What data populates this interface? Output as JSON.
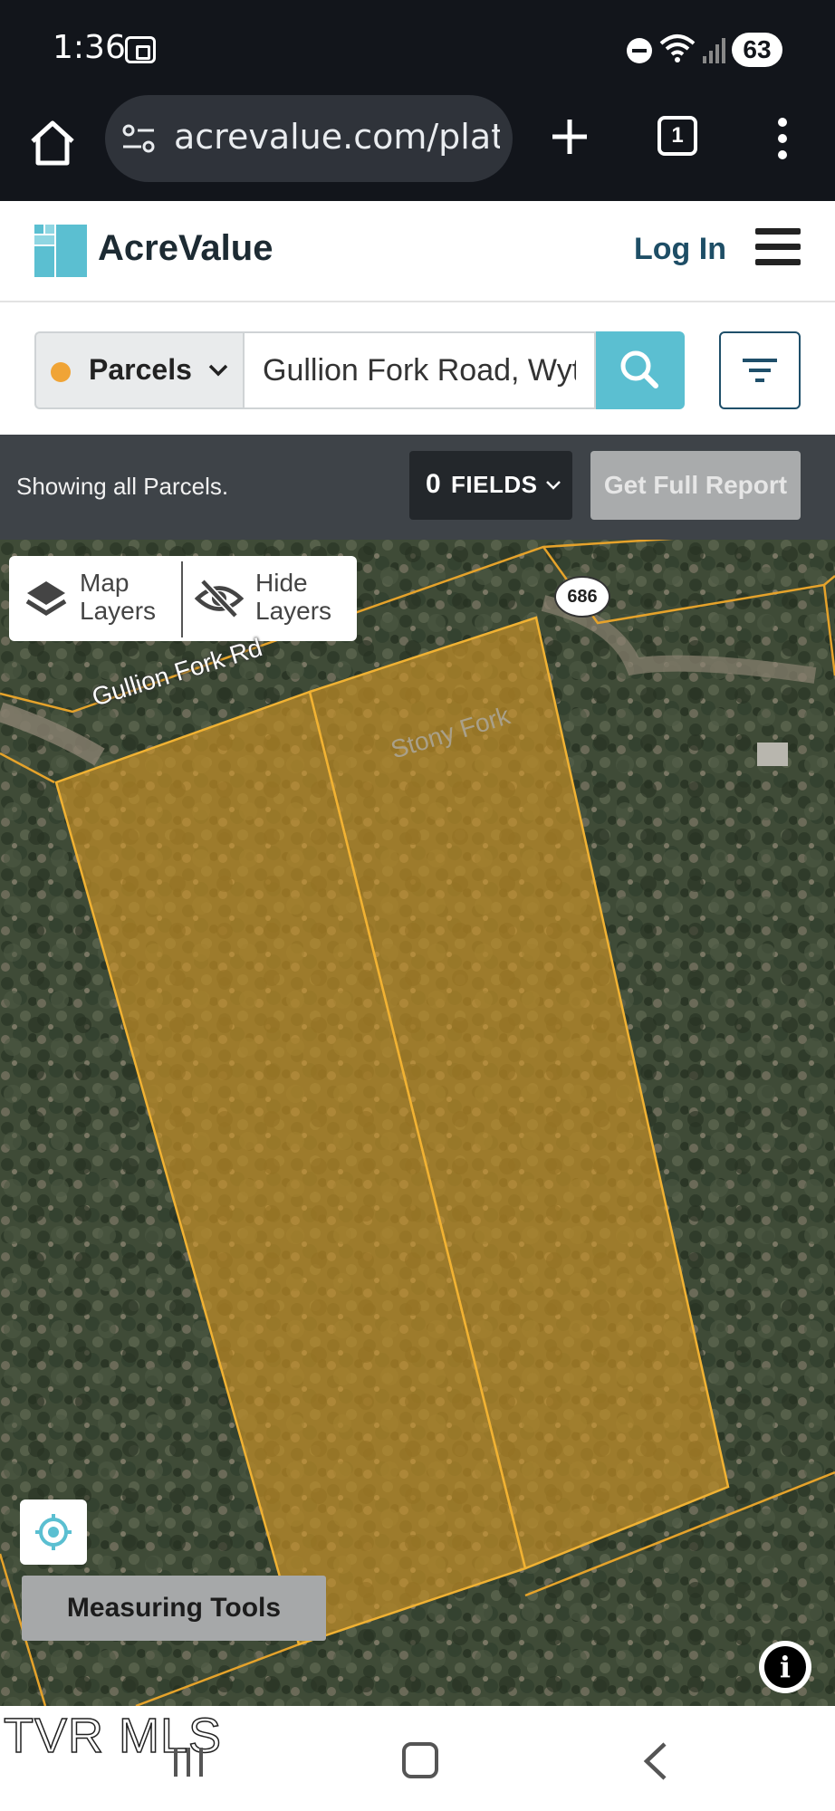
{
  "status_bar": {
    "time": "1:36",
    "battery": "63",
    "icons": [
      "screenshot-icon",
      "do-not-disturb-icon",
      "wifi-icon",
      "signal-icon",
      "battery-icon"
    ]
  },
  "browser": {
    "url": "acrevalue.com/plat-r",
    "tab_count": "1"
  },
  "header": {
    "brand": "AcreValue",
    "login_label": "Log In",
    "brand_colors": [
      "#5bbfd1",
      "#1d2b33"
    ]
  },
  "search": {
    "layer_selected": "Parcels",
    "layer_dot_color": "#f0a436",
    "query": "Gullion Fork Road, Wytl"
  },
  "info_bar": {
    "message": "Showing all Parcels.",
    "fields_count": "0",
    "fields_label": "FIELDS",
    "report_label": "Get Full Report"
  },
  "map": {
    "map_layers_label_1": "Map",
    "map_layers_label_2": "Layers",
    "hide_layers_label_1": "Hide",
    "hide_layers_label_2": "Layers",
    "route_number": "686",
    "road_name": "Gullion Fork Rd",
    "parcel_name": "Stony Fork",
    "measuring_tools_label": "Measuring Tools",
    "parcel_color": "#e6a32b",
    "info_glyph": "i"
  },
  "nav": {
    "watermark": "TVR MLS"
  }
}
